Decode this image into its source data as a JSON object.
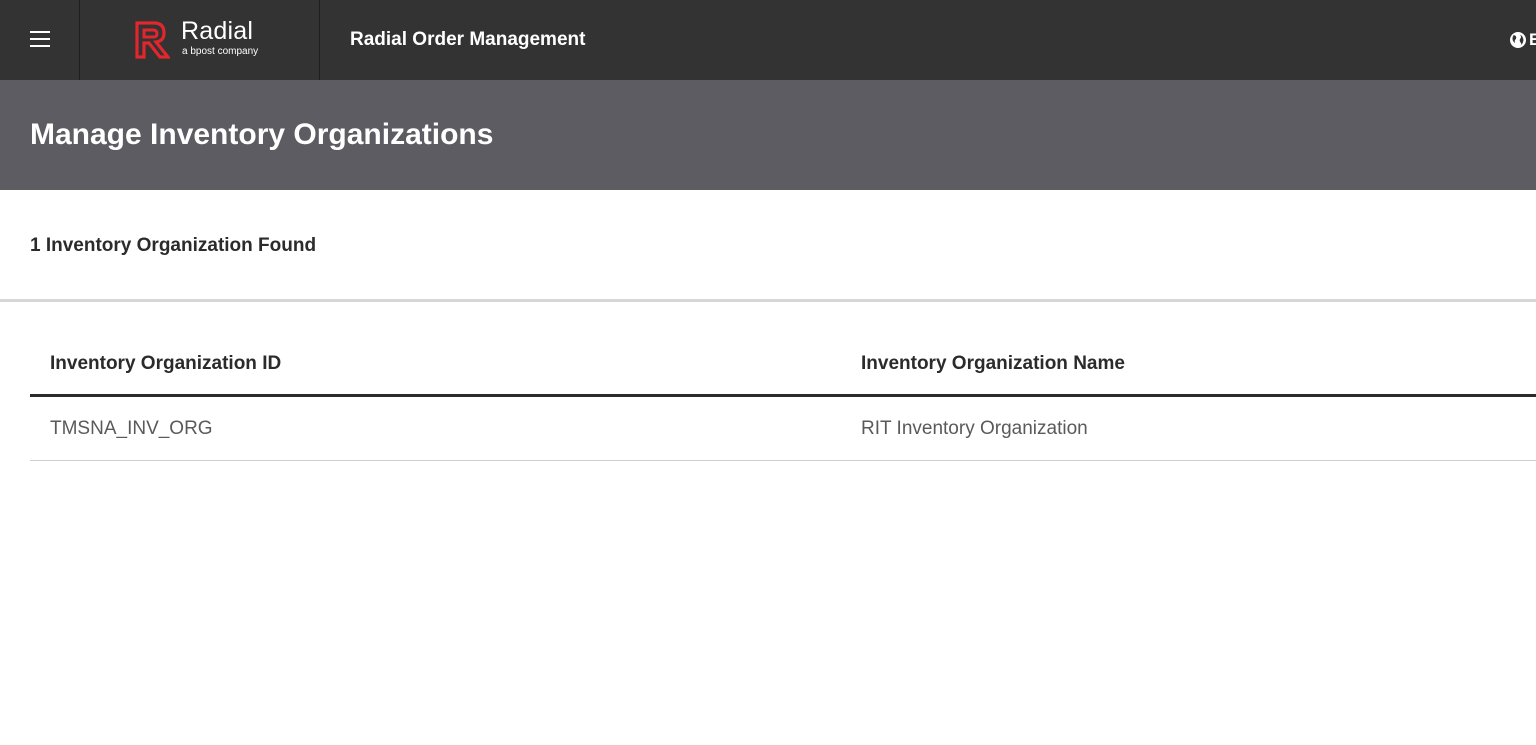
{
  "header": {
    "brand_name": "Radial",
    "brand_tagline": "a bpost company",
    "app_title": "Radial Order Management",
    "globe_label": "E",
    "icons": {
      "menu": "hamburger-icon",
      "logo": "radial-r-logo",
      "locale": "globe-icon"
    },
    "colors": {
      "bar": "#333333",
      "brand_red": "#e1262d"
    }
  },
  "page": {
    "title": "Manage Inventory Organizations",
    "header_color": "#5c5c62"
  },
  "results": {
    "count_text": "1 Inventory Organization Found"
  },
  "table": {
    "columns": [
      "Inventory Organization ID",
      "Inventory Organization Name"
    ],
    "rows": [
      [
        "TMSNA_INV_ORG",
        "RIT Inventory Organization"
      ]
    ]
  }
}
